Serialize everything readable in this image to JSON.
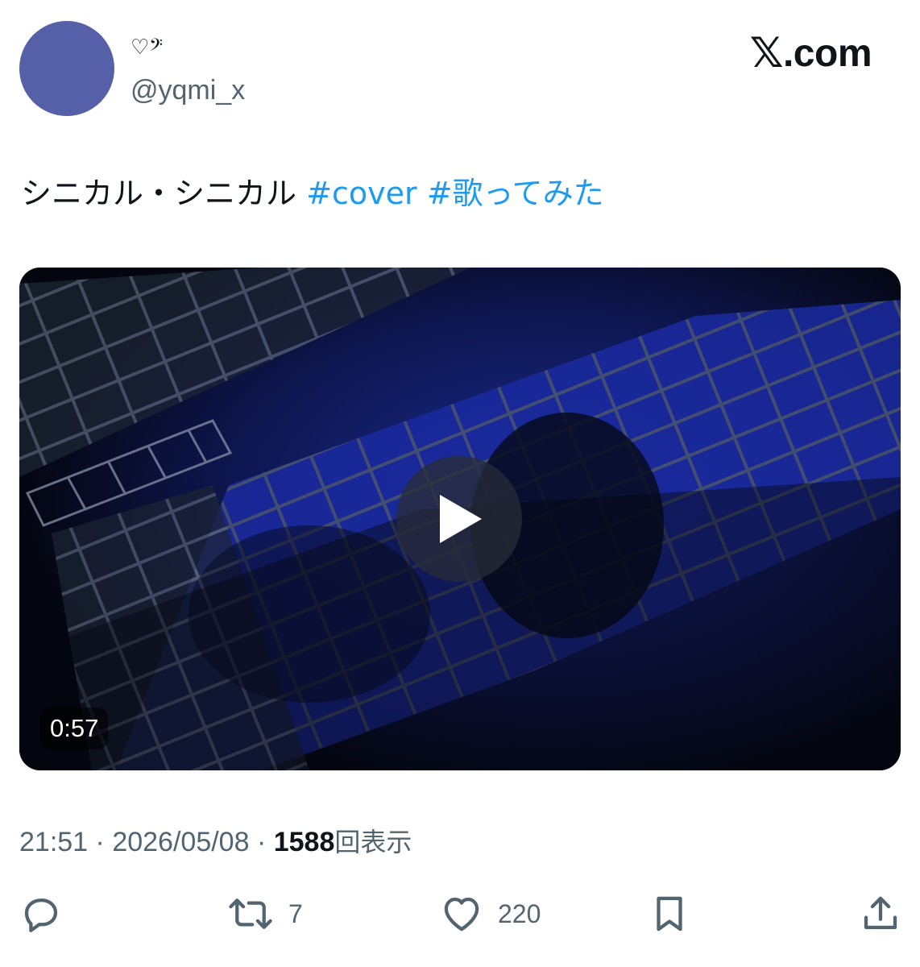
{
  "author": {
    "display_name": "♡𝄢",
    "handle": "@yqmi_x",
    "avatar_color": "#5660a8"
  },
  "brand": {
    "logo_mark": "𝕏",
    "logo_text": ".com"
  },
  "tweet": {
    "text": "シニカル・シニカル",
    "hashtags": [
      "#cover",
      "#歌ってみた"
    ],
    "hashtag_color": "#1d9bf0"
  },
  "video": {
    "duration": "0:57",
    "play_icon": "play-icon"
  },
  "meta": {
    "time": "21:51",
    "separator": "·",
    "date": "2026/05/08",
    "views_count": "1588",
    "views_label": "回表示"
  },
  "actions": {
    "reply": {
      "icon": "reply-icon",
      "count": ""
    },
    "retweet": {
      "icon": "retweet-icon",
      "count": "7"
    },
    "like": {
      "icon": "heart-icon",
      "count": "220"
    },
    "bookmark": {
      "icon": "bookmark-icon",
      "count": ""
    },
    "share": {
      "icon": "share-icon",
      "count": ""
    }
  }
}
